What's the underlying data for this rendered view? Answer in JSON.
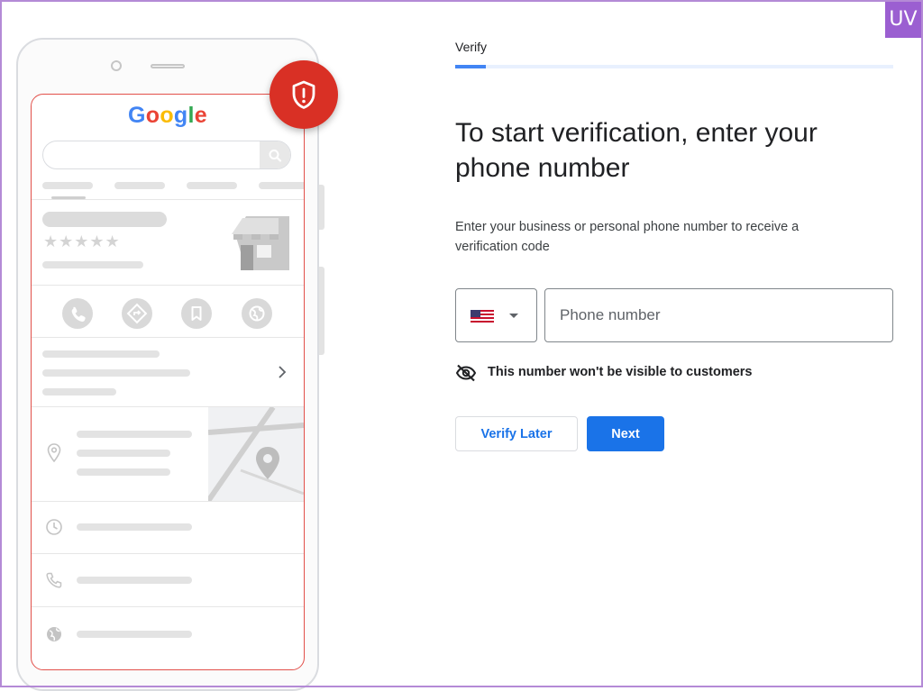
{
  "watermark": {
    "text": "UV"
  },
  "illustration": {
    "brand_letters": [
      {
        "ch": "G",
        "color": "#4285F4"
      },
      {
        "ch": "o",
        "color": "#EA4335"
      },
      {
        "ch": "o",
        "color": "#FBBC05"
      },
      {
        "ch": "g",
        "color": "#4285F4"
      },
      {
        "ch": "l",
        "color": "#34A853"
      },
      {
        "ch": "e",
        "color": "#EA4335"
      }
    ],
    "rating_stars": "★★★★★"
  },
  "stepper": {
    "label": "Verify",
    "progress_fraction": 0.07
  },
  "heading": "To start verification, enter your phone number",
  "description": "Enter your business or personal phone number to receive a verification code",
  "country_select": {
    "selected": "US flag"
  },
  "phone_input": {
    "value": "",
    "placeholder": "Phone number"
  },
  "visibility_note": {
    "icon": "eye-off-icon",
    "text": "This number won't be visible to customers"
  },
  "buttons": {
    "verify_later": "Verify Later",
    "next": "Next"
  },
  "colors": {
    "primary": "#1a73e8",
    "progress": "#4285f4",
    "shield_badge": "#d93025",
    "screen_outline": "#e2504a"
  }
}
